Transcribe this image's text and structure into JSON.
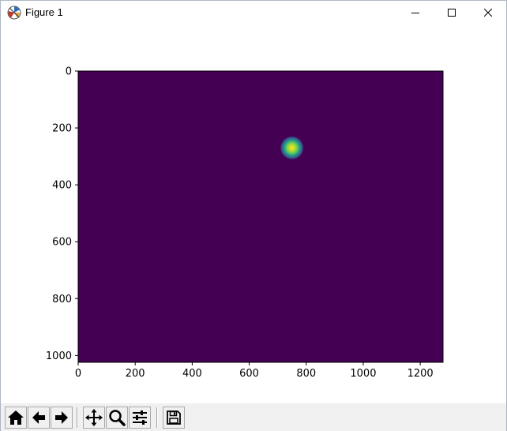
{
  "window": {
    "title": "Figure 1",
    "controls": [
      "minimize-icon",
      "maximize-icon",
      "close-icon"
    ]
  },
  "toolbar": {
    "buttons": [
      "home-icon",
      "back-icon",
      "forward-icon",
      "pan-icon",
      "zoom-icon",
      "configure-subplots-icon",
      "save-icon"
    ]
  },
  "colors": {
    "background": "#440154",
    "spot_edge": "#21918c",
    "spot_mid": "#5ec962",
    "spot_center": "#fde725"
  },
  "chart_data": {
    "type": "heatmap",
    "title": "",
    "xlabel": "",
    "ylabel": "",
    "colormap": "viridis",
    "image_size": [
      1280,
      1024
    ],
    "xlim": [
      0,
      1280
    ],
    "ylim": [
      1024,
      0
    ],
    "y_inverted": true,
    "x_ticks": [
      "0",
      "200",
      "400",
      "600",
      "800",
      "1000",
      "1200"
    ],
    "y_ticks": [
      "0",
      "200",
      "400",
      "600",
      "800",
      "1000"
    ],
    "background_value": 0,
    "peak": {
      "x": 750,
      "y": 270,
      "value": 1,
      "sigma": 12
    },
    "grid": false
  }
}
